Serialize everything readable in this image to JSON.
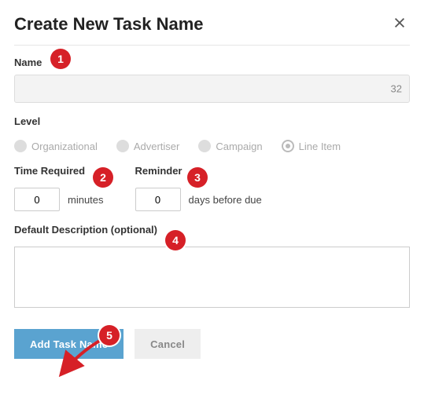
{
  "dialog": {
    "title": "Create New Task Name"
  },
  "name": {
    "label": "Name",
    "value": "",
    "char_count": "32"
  },
  "level": {
    "label": "Level",
    "options": [
      {
        "label": "Organizational",
        "selected": false
      },
      {
        "label": "Advertiser",
        "selected": false
      },
      {
        "label": "Campaign",
        "selected": false
      },
      {
        "label": "Line Item",
        "selected": true
      }
    ]
  },
  "time_required": {
    "label": "Time Required",
    "value": "0",
    "suffix": "minutes"
  },
  "reminder": {
    "label": "Reminder",
    "value": "0",
    "suffix": "days before due"
  },
  "description": {
    "label": "Default Description (optional)",
    "value": ""
  },
  "buttons": {
    "primary": "Add Task Name",
    "secondary": "Cancel"
  },
  "callouts": [
    "1",
    "2",
    "3",
    "4",
    "5"
  ]
}
